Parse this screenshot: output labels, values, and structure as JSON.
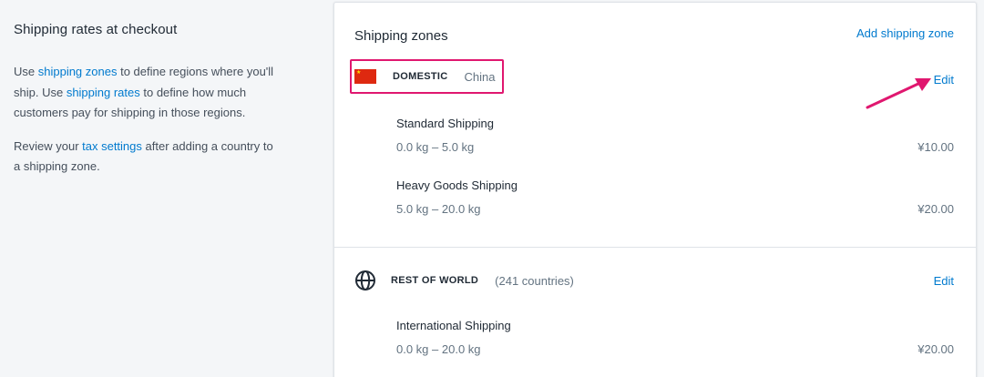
{
  "aside": {
    "title": "Shipping rates at checkout",
    "para1_prefix": "Use ",
    "para1_link1": "shipping zones",
    "para1_mid1": " to define regions where you'll ship. Use ",
    "para1_link2": "shipping rates",
    "para1_suffix": " to define how much customers pay for shipping in those regions.",
    "para2_prefix": "Review your ",
    "para2_link": "tax settings",
    "para2_suffix": " after adding a country to a shipping zone."
  },
  "card": {
    "title": "Shipping zones",
    "add_zone_label": "Add shipping zone"
  },
  "zones": [
    {
      "name": "DOMESTIC",
      "meta": "China",
      "icon": "china-flag-icon",
      "edit_label": "Edit",
      "rates": [
        {
          "name": "Standard Shipping",
          "range": "0.0 kg – 5.0 kg",
          "price": "¥10.00"
        },
        {
          "name": "Heavy Goods Shipping",
          "range": "5.0 kg – 20.0 kg",
          "price": "¥20.00"
        }
      ]
    },
    {
      "name": "REST OF WORLD",
      "meta": "(241 countries)",
      "icon": "globe-icon",
      "edit_label": "Edit",
      "rates": [
        {
          "name": "International Shipping",
          "range": "0.0 kg – 20.0 kg",
          "price": "¥20.00"
        }
      ]
    }
  ],
  "colors": {
    "link": "#007ace",
    "highlight": "#e0176f",
    "flag_red": "#de2910",
    "flag_yellow": "#ffde00"
  }
}
